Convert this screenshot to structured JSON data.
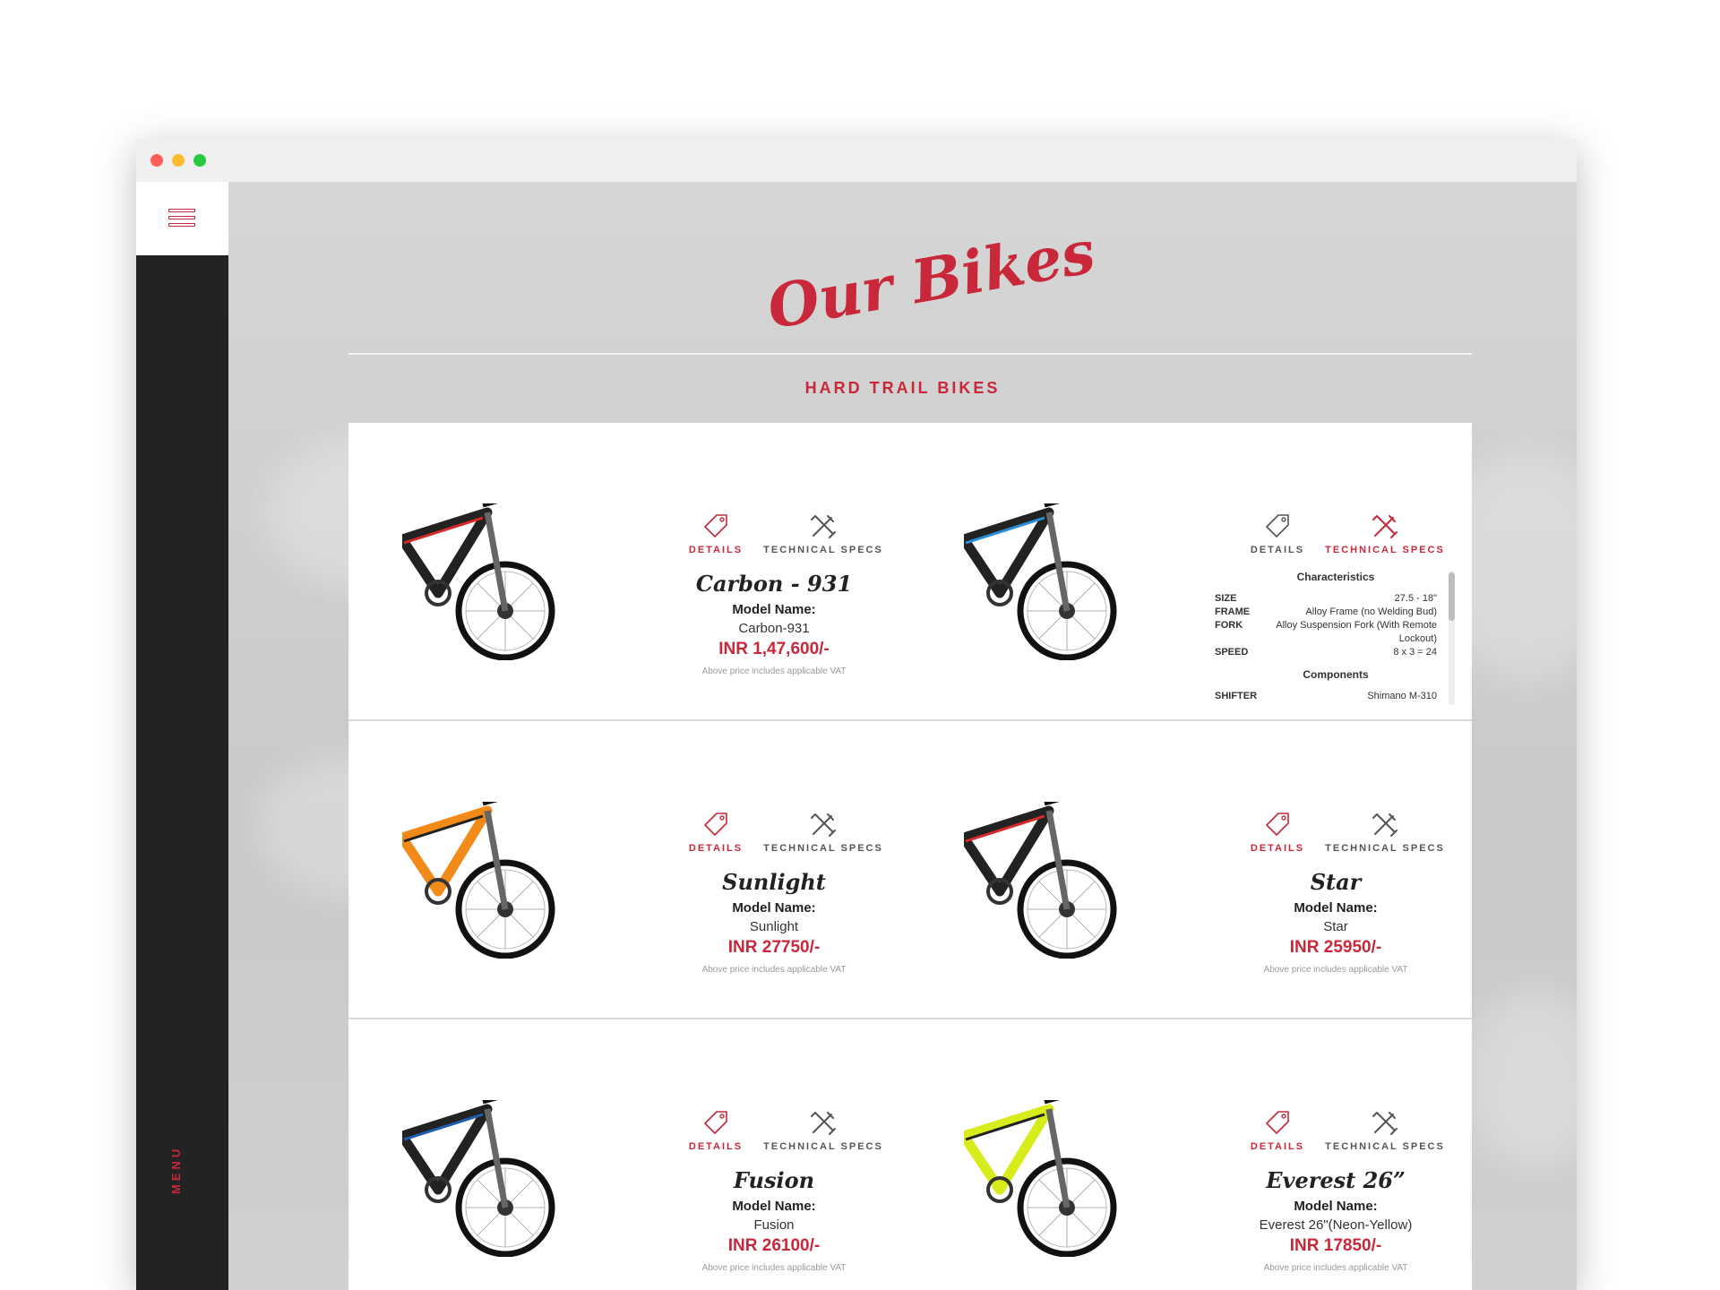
{
  "app": {
    "title": "Our Bikes",
    "section": "HARD TRAIL BIKES",
    "menu_label": "MENU"
  },
  "colors": {
    "accent": "#c8283a",
    "sidebar": "#232323"
  },
  "tabs": {
    "details": "DETAILS",
    "specs": "TECHNICAL SPECS"
  },
  "labels": {
    "model_name": "Model Name:",
    "vat_note": "Above price includes applicable VAT"
  },
  "bikes": [
    {
      "name": "Carbon - 931",
      "model": "Carbon-931",
      "price": "INR 1,47,600/-",
      "frame_color": "#222222",
      "accent": "#d42a2a",
      "active_tab": "details"
    },
    {
      "name": "",
      "model": "",
      "price": "",
      "frame_color": "#222222",
      "accent": "#2a8ed6",
      "active_tab": "specs"
    },
    {
      "name": "Sunlight",
      "model": "Sunlight",
      "price": "INR 27750/-",
      "frame_color": "#f28a1a",
      "accent": "#222222",
      "active_tab": "details"
    },
    {
      "name": "Star",
      "model": "Star",
      "price": "INR 25950/-",
      "frame_color": "#222222",
      "accent": "#d42a2a",
      "active_tab": "details"
    },
    {
      "name": "Fusion",
      "model": "Fusion",
      "price": "INR 26100/-",
      "frame_color": "#222222",
      "accent": "#1f5fb0",
      "active_tab": "details"
    },
    {
      "name": "Everest 26”",
      "model": "Everest 26\"(Neon-Yellow)",
      "price": "INR 17850/-",
      "frame_color": "#d8ec1c",
      "accent": "#222222",
      "active_tab": "details"
    }
  ],
  "specs": {
    "characteristics_title": "Characteristics",
    "components_title": "Components",
    "characteristics": [
      {
        "key": "SIZE",
        "value": "27.5 - 18\""
      },
      {
        "key": "FRAME",
        "value": "Alloy Frame (no Welding Bud)"
      },
      {
        "key": "FORK",
        "value": "Alloy Suspension Fork (With Remote Lockout)"
      },
      {
        "key": "SPEED",
        "value": "8 x 3 = 24"
      }
    ],
    "components": [
      {
        "key": "SHIFTER",
        "value": "Shimano M-310"
      }
    ]
  }
}
